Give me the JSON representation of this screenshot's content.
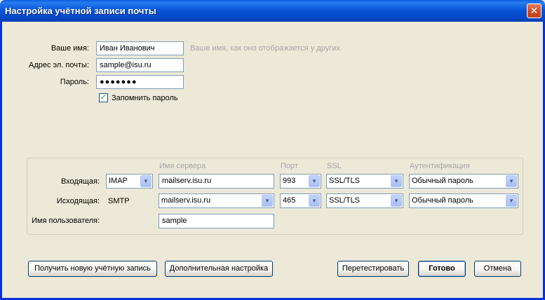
{
  "window": {
    "title": "Настройка учётной записи почты",
    "close": "✕"
  },
  "form": {
    "name_label": "Ваше имя:",
    "name_value": "Иван Иванович",
    "name_hint": "Ваше имя, как оно отображается у других",
    "email_label": "Адрес эл. почты:",
    "email_value": "sample@isu.ru",
    "password_label": "Пароль:",
    "password_value": "●●●●●●●",
    "remember_label": "Запомнить пароль",
    "remember_checked": "✓"
  },
  "servers": {
    "headers": {
      "server": "Имя сервера",
      "port": "Порт",
      "ssl": "SSL",
      "auth": "Аутентификация"
    },
    "incoming": {
      "label": "Входящая:",
      "protocol": "IMAP",
      "server": "mailserv.isu.ru",
      "port": "993",
      "ssl": "SSL/TLS",
      "auth": "Обычный пароль"
    },
    "outgoing": {
      "label": "Исходящая:",
      "protocol": "SMTP",
      "server": "mailserv.isu.ru",
      "port": "465",
      "ssl": "SSL/TLS",
      "auth": "Обычный пароль"
    },
    "username_label": "Имя пользователя:",
    "username_value": "sample"
  },
  "buttons": {
    "new_account": "Получить новую учётную запись",
    "advanced": "Дополнительная настройка",
    "retest": "Перетестировать",
    "done": "Готово",
    "cancel": "Отмена"
  },
  "icons": {
    "dropdown": "▼"
  }
}
